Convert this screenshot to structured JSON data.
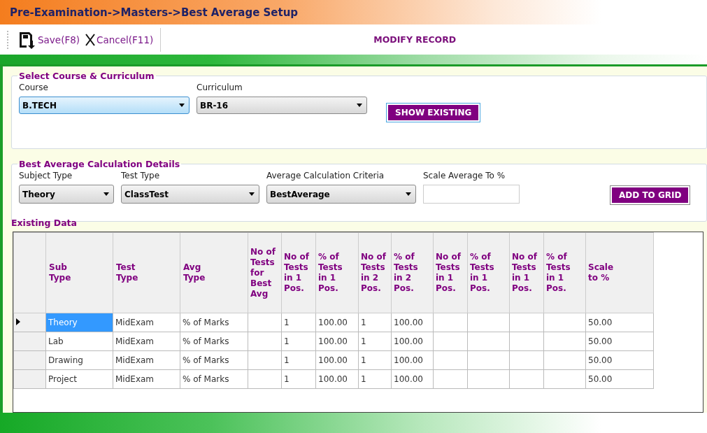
{
  "window": {
    "title": "Pre-Examination->Masters->Best Average Setup"
  },
  "toolbar": {
    "buttons": [
      {
        "label": "Save(F8)",
        "kind": "save"
      },
      {
        "label": "Cancel(F11)",
        "kind": "cancel"
      }
    ],
    "mode": "MODIFY RECORD"
  },
  "course_group": {
    "title": "Select Course & Curriculum",
    "fields": [
      {
        "label": "Course",
        "value": "B.TECH",
        "focused": true
      },
      {
        "label": "Curriculum",
        "value": "BR-16",
        "focused": false
      }
    ],
    "button": "SHOW EXISTING"
  },
  "details_group": {
    "title": "Best Average Calculation Details",
    "fields": [
      {
        "label": "Subject Type",
        "value": "Theory",
        "kind": "dropdown"
      },
      {
        "label": "Test Type",
        "value": "ClassTest",
        "kind": "dropdown"
      },
      {
        "label": "Average Calculation Criteria",
        "value": "BestAverage",
        "kind": "dropdown"
      },
      {
        "label": "Scale Average To %",
        "kind": "text"
      }
    ],
    "button": "ADD TO GRID"
  },
  "existing": {
    "title": "Existing Data",
    "columns": [
      "Sub Type",
      "Test Type",
      "Avg Type",
      "No of Tests for Best Avg",
      "No of Tests in 1 Pos.",
      "% of Tests in 1 Pos.",
      "No of Tests in 2 Pos.",
      "% of Tests in 2 Pos.",
      "No of Tests in 1 Pos.",
      "% of Tests in 1 Pos.",
      "No of Tests in 1 Pos.",
      "% of Tests in 1 Pos.",
      "Scale to %"
    ],
    "rows": [
      {
        "selected": true,
        "cells": [
          "Theory",
          "MidExam",
          "% of Marks",
          null,
          "1",
          "100.00",
          "1",
          "100.00",
          null,
          null,
          null,
          null,
          "50.00"
        ]
      },
      {
        "selected": false,
        "cells": [
          "Lab",
          "MidExam",
          "% of Marks",
          null,
          "1",
          "100.00",
          "1",
          "100.00",
          null,
          null,
          null,
          null,
          "50.00"
        ]
      },
      {
        "selected": false,
        "cells": [
          "Drawing",
          "MidExam",
          "% of Marks",
          null,
          "1",
          "100.00",
          "1",
          "100.00",
          null,
          null,
          null,
          null,
          "50.00"
        ]
      },
      {
        "selected": false,
        "cells": [
          "Project",
          "MidExam",
          "% of Marks",
          null,
          "1",
          "100.00",
          "1",
          "100.00",
          null,
          null,
          null,
          null,
          "50.00"
        ]
      }
    ]
  }
}
